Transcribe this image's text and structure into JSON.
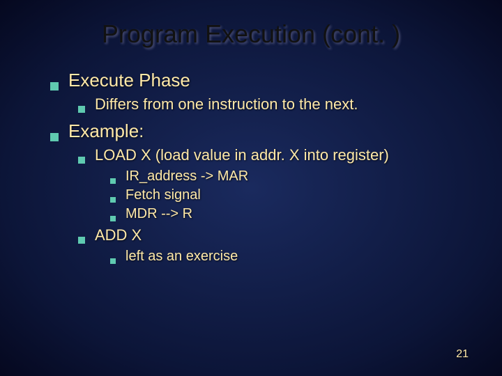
{
  "title": "Program Execution (cont. )",
  "bullets": {
    "b1": "Execute Phase",
    "b1_1": "Differs from one instruction to the next.",
    "b2": "Example:",
    "b2_1": "LOAD X (load value in addr. X into register)",
    "b2_1_1": "IR_address -> MAR",
    "b2_1_2": "Fetch signal",
    "b2_1_3": "MDR --> R",
    "b2_2": "ADD X",
    "b2_2_1": "left as an exercise"
  },
  "page_number": "21"
}
